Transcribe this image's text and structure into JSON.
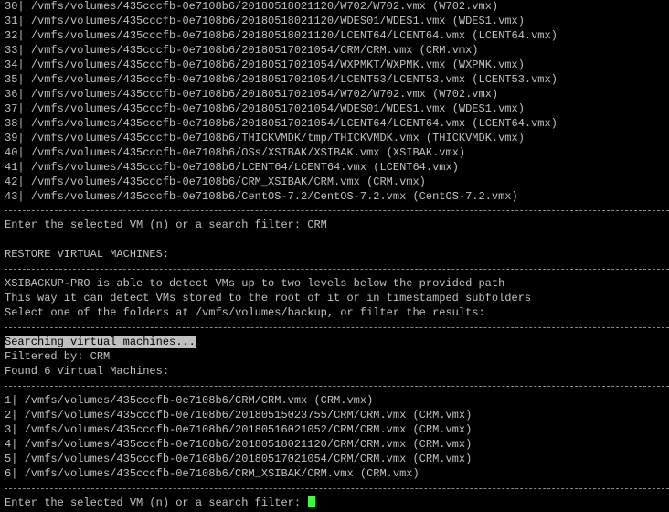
{
  "colors": {
    "background": "#000000",
    "foreground": "#c0c0c0",
    "cursor": "#3cff3c",
    "highlight_bg": "#c0c0c0"
  },
  "vm_list_top": [
    {
      "n": "30|",
      "path": "/vmfs/volumes/435cccfb-0e7108b6/20180518021120/W702/W702.vmx (W702.vmx)"
    },
    {
      "n": "31|",
      "path": "/vmfs/volumes/435cccfb-0e7108b6/20180518021120/WDES01/WDES1.vmx (WDES1.vmx)"
    },
    {
      "n": "32|",
      "path": "/vmfs/volumes/435cccfb-0e7108b6/20180518021120/LCENT64/LCENT64.vmx (LCENT64.vmx)"
    },
    {
      "n": "33|",
      "path": "/vmfs/volumes/435cccfb-0e7108b6/20180517021054/CRM/CRM.vmx (CRM.vmx)"
    },
    {
      "n": "34|",
      "path": "/vmfs/volumes/435cccfb-0e7108b6/20180517021054/WXPMKT/WXPMK.vmx (WXPMK.vmx)"
    },
    {
      "n": "35|",
      "path": "/vmfs/volumes/435cccfb-0e7108b6/20180517021054/LCENT53/LCENT53.vmx (LCENT53.vmx)"
    },
    {
      "n": "36|",
      "path": "/vmfs/volumes/435cccfb-0e7108b6/20180517021054/W702/W702.vmx (W702.vmx)"
    },
    {
      "n": "37|",
      "path": "/vmfs/volumes/435cccfb-0e7108b6/20180517021054/WDES01/WDES1.vmx (WDES1.vmx)"
    },
    {
      "n": "38|",
      "path": "/vmfs/volumes/435cccfb-0e7108b6/20180517021054/LCENT64/LCENT64.vmx (LCENT64.vmx)"
    },
    {
      "n": "39|",
      "path": "/vmfs/volumes/435cccfb-0e7108b6/THICKVMDK/tmp/THICKVMDK.vmx (THICKVMDK.vmx)"
    },
    {
      "n": "40|",
      "path": "/vmfs/volumes/435cccfb-0e7108b6/OSs/XSIBAK/XSIBAK.vmx (XSIBAK.vmx)"
    },
    {
      "n": "41|",
      "path": "/vmfs/volumes/435cccfb-0e7108b6/LCENT64/LCENT64.vmx (LCENT64.vmx)"
    },
    {
      "n": "42|",
      "path": "/vmfs/volumes/435cccfb-0e7108b6/CRM_XSIBAK/CRM.vmx (CRM.vmx)"
    },
    {
      "n": "43|",
      "path": "/vmfs/volumes/435cccfb-0e7108b6/CentOS-7.2/CentOS-7.2.vmx (CentOS-7.2.vmx)"
    }
  ],
  "prompt1": "Enter the selected VM (n) or a search filter: CRM",
  "restore_header": "RESTORE VIRTUAL MACHINES:",
  "info": [
    "XSIBACKUP-PRO is able to detect VMs up to two levels below the provided path",
    "This way it can detect VMs stored to the root of it or in timestamped subfolders",
    "Select one of the folders at /vmfs/volumes/backup, or filter the results:"
  ],
  "searching": "Searching virtual machines...",
  "filtered_by": "Filtered by: CRM",
  "found": "Found 6 Virtual Machines:",
  "vm_list_filtered": [
    {
      "n": "1|",
      "path": "/vmfs/volumes/435cccfb-0e7108b6/CRM/CRM.vmx (CRM.vmx)"
    },
    {
      "n": "2|",
      "path": "/vmfs/volumes/435cccfb-0e7108b6/20180515023755/CRM/CRM.vmx (CRM.vmx)"
    },
    {
      "n": "3|",
      "path": "/vmfs/volumes/435cccfb-0e7108b6/20180516021052/CRM/CRM.vmx (CRM.vmx)"
    },
    {
      "n": "4|",
      "path": "/vmfs/volumes/435cccfb-0e7108b6/20180518021120/CRM/CRM.vmx (CRM.vmx)"
    },
    {
      "n": "5|",
      "path": "/vmfs/volumes/435cccfb-0e7108b6/20180517021054/CRM/CRM.vmx (CRM.vmx)"
    },
    {
      "n": "6|",
      "path": "/vmfs/volumes/435cccfb-0e7108b6/CRM_XSIBAK/CRM.vmx (CRM.vmx)"
    }
  ],
  "prompt2": "Enter the selected VM (n) or a search filter: "
}
